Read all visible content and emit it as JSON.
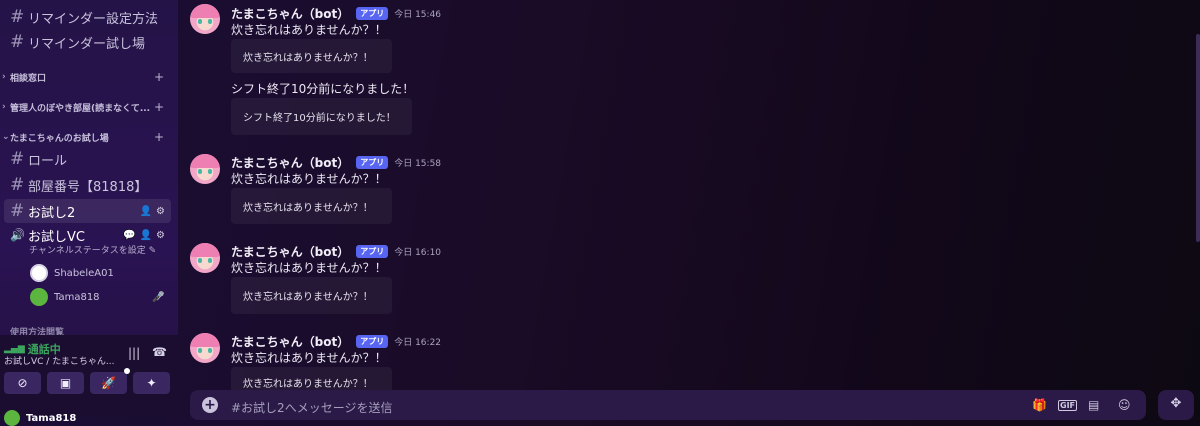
{
  "sidebar": {
    "channels_top": [
      {
        "label": "リマインダー設定方法"
      },
      {
        "label": "リマインダー試し場"
      }
    ],
    "categories": [
      {
        "label": "相談窓口"
      },
      {
        "label": "管理人のぼやき部屋(読まなくて..."
      },
      {
        "label": "たまこちゃんのお試し場"
      }
    ],
    "channels_cat": [
      {
        "label": "ロール"
      },
      {
        "label": "部屋番号【81818】"
      },
      {
        "label": "お試し2"
      }
    ],
    "voice_channel": {
      "label": "お試しVC",
      "status_label": "チャンネルステータスを設定",
      "users": [
        {
          "name": "ShabeleA01"
        },
        {
          "name": "Tama818"
        }
      ]
    },
    "hidden_category": "使用方法閲覧",
    "voice_panel": {
      "status": "通話中",
      "location": "お試しVC / たまこちゃん...",
      "bottom_user": "Tama818"
    }
  },
  "messages": [
    {
      "author": "たまこちゃん（bot）",
      "badge": "アプリ",
      "time": "今日 15:46",
      "lines": [
        {
          "text": "炊き忘れはありませんか？！",
          "embed": "炊き忘れはありませんか？！"
        },
        {
          "text": "シフト終了10分前になりました！",
          "embed": "シフト終了10分前になりました！"
        }
      ]
    },
    {
      "author": "たまこちゃん（bot）",
      "badge": "アプリ",
      "time": "今日 15:58",
      "lines": [
        {
          "text": "炊き忘れはありませんか？！",
          "embed": "炊き忘れはありませんか？！"
        }
      ]
    },
    {
      "author": "たまこちゃん（bot）",
      "badge": "アプリ",
      "time": "今日 16:10",
      "lines": [
        {
          "text": "炊き忘れはありませんか？！",
          "embed": "炊き忘れはありませんか？！"
        }
      ]
    },
    {
      "author": "たまこちゃん（bot）",
      "badge": "アプリ",
      "time": "今日 16:22",
      "lines": [
        {
          "text": "炊き忘れはありませんか？！",
          "embed": "炊き忘れはありませんか？！"
        }
      ]
    }
  ],
  "composer": {
    "placeholder": "#お試し2へメッセージを送信",
    "gif_label": "GIF"
  },
  "icons": {
    "hash": "hash-icon",
    "speaker": "speaker-icon",
    "gear": "gear-icon",
    "add-user": "add-user-icon",
    "gift": "gift-icon",
    "sticker": "sticker-icon",
    "emoji": "emoji-icon",
    "apps": "apps-icon"
  },
  "colors": {
    "accent": "#5865f2",
    "connected": "#3ba55d"
  }
}
